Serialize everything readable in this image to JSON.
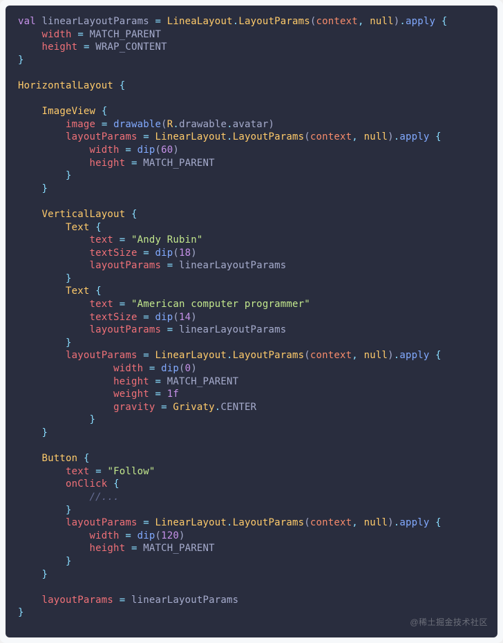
{
  "watermark": "@稀土掘金技术社区",
  "code": {
    "tokens": [
      [
        [
          "kw-val",
          "val"
        ],
        [
          "plain",
          " "
        ],
        [
          "name",
          "linearLayoutParams"
        ],
        [
          "plain",
          " "
        ],
        [
          "op",
          "="
        ],
        [
          "plain",
          " "
        ],
        [
          "type",
          "LineaLayout"
        ],
        [
          "punct",
          "."
        ],
        [
          "type",
          "LayoutParams"
        ],
        [
          "paren",
          "("
        ],
        [
          "param",
          "context"
        ],
        [
          "punct",
          ","
        ],
        [
          "plain",
          " "
        ],
        [
          "type",
          "null"
        ],
        [
          "paren",
          ")"
        ],
        [
          "punct",
          "."
        ],
        [
          "func",
          "apply"
        ],
        [
          "plain",
          " "
        ],
        [
          "punct",
          "{"
        ]
      ],
      [
        [
          "plain",
          "    "
        ],
        [
          "prop",
          "width"
        ],
        [
          "plain",
          " "
        ],
        [
          "op",
          "="
        ],
        [
          "plain",
          " "
        ],
        [
          "const",
          "MATCH_PARENT"
        ]
      ],
      [
        [
          "plain",
          "    "
        ],
        [
          "prop",
          "height"
        ],
        [
          "plain",
          " "
        ],
        [
          "op",
          "="
        ],
        [
          "plain",
          " "
        ],
        [
          "const",
          "WRAP_CONTENT"
        ]
      ],
      [
        [
          "punct",
          "}"
        ]
      ],
      [],
      [
        [
          "type",
          "HorizontalLayout"
        ],
        [
          "plain",
          " "
        ],
        [
          "punct",
          "{"
        ]
      ],
      [],
      [
        [
          "plain",
          "    "
        ],
        [
          "type",
          "ImageView"
        ],
        [
          "plain",
          " "
        ],
        [
          "punct",
          "{"
        ]
      ],
      [
        [
          "plain",
          "        "
        ],
        [
          "prop",
          "image"
        ],
        [
          "plain",
          " "
        ],
        [
          "op",
          "="
        ],
        [
          "plain",
          " "
        ],
        [
          "func",
          "drawable"
        ],
        [
          "paren",
          "("
        ],
        [
          "type",
          "R"
        ],
        [
          "punct",
          "."
        ],
        [
          "name",
          "drawable"
        ],
        [
          "punct",
          "."
        ],
        [
          "name",
          "avatar"
        ],
        [
          "paren",
          ")"
        ]
      ],
      [
        [
          "plain",
          "        "
        ],
        [
          "prop",
          "layoutParams"
        ],
        [
          "plain",
          " "
        ],
        [
          "op",
          "="
        ],
        [
          "plain",
          " "
        ],
        [
          "type",
          "LinearLayout"
        ],
        [
          "punct",
          "."
        ],
        [
          "type",
          "LayoutParams"
        ],
        [
          "paren",
          "("
        ],
        [
          "param",
          "context"
        ],
        [
          "punct",
          ","
        ],
        [
          "plain",
          " "
        ],
        [
          "type",
          "null"
        ],
        [
          "paren",
          ")"
        ],
        [
          "punct",
          "."
        ],
        [
          "func",
          "apply"
        ],
        [
          "plain",
          " "
        ],
        [
          "punct",
          "{"
        ]
      ],
      [
        [
          "plain",
          "            "
        ],
        [
          "prop",
          "width"
        ],
        [
          "plain",
          " "
        ],
        [
          "op",
          "="
        ],
        [
          "plain",
          " "
        ],
        [
          "func",
          "dip"
        ],
        [
          "paren",
          "("
        ],
        [
          "num",
          "60"
        ],
        [
          "paren",
          ")"
        ]
      ],
      [
        [
          "plain",
          "            "
        ],
        [
          "prop",
          "height"
        ],
        [
          "plain",
          " "
        ],
        [
          "op",
          "="
        ],
        [
          "plain",
          " "
        ],
        [
          "const",
          "MATCH_PARENT"
        ]
      ],
      [
        [
          "plain",
          "        "
        ],
        [
          "punct",
          "}"
        ]
      ],
      [
        [
          "plain",
          "    "
        ],
        [
          "punct",
          "}"
        ]
      ],
      [],
      [
        [
          "plain",
          "    "
        ],
        [
          "type",
          "VerticalLayout"
        ],
        [
          "plain",
          " "
        ],
        [
          "punct",
          "{"
        ]
      ],
      [
        [
          "plain",
          "        "
        ],
        [
          "type",
          "Text"
        ],
        [
          "plain",
          " "
        ],
        [
          "punct",
          "{"
        ]
      ],
      [
        [
          "plain",
          "            "
        ],
        [
          "prop",
          "text"
        ],
        [
          "plain",
          " "
        ],
        [
          "op",
          "="
        ],
        [
          "plain",
          " "
        ],
        [
          "str",
          "\"Andy Rubin\""
        ]
      ],
      [
        [
          "plain",
          "            "
        ],
        [
          "prop",
          "textSize"
        ],
        [
          "plain",
          " "
        ],
        [
          "op",
          "="
        ],
        [
          "plain",
          " "
        ],
        [
          "func",
          "dip"
        ],
        [
          "paren",
          "("
        ],
        [
          "num",
          "18"
        ],
        [
          "paren",
          ")"
        ]
      ],
      [
        [
          "plain",
          "            "
        ],
        [
          "prop",
          "layoutParams"
        ],
        [
          "plain",
          " "
        ],
        [
          "op",
          "="
        ],
        [
          "plain",
          " "
        ],
        [
          "name",
          "linearLayoutParams"
        ]
      ],
      [
        [
          "plain",
          "        "
        ],
        [
          "punct",
          "}"
        ]
      ],
      [
        [
          "plain",
          "        "
        ],
        [
          "type",
          "Text"
        ],
        [
          "plain",
          " "
        ],
        [
          "punct",
          "{"
        ]
      ],
      [
        [
          "plain",
          "            "
        ],
        [
          "prop",
          "text"
        ],
        [
          "plain",
          " "
        ],
        [
          "op",
          "="
        ],
        [
          "plain",
          " "
        ],
        [
          "str",
          "\"American computer programmer\""
        ]
      ],
      [
        [
          "plain",
          "            "
        ],
        [
          "prop",
          "textSize"
        ],
        [
          "plain",
          " "
        ],
        [
          "op",
          "="
        ],
        [
          "plain",
          " "
        ],
        [
          "func",
          "dip"
        ],
        [
          "paren",
          "("
        ],
        [
          "num",
          "14"
        ],
        [
          "paren",
          ")"
        ]
      ],
      [
        [
          "plain",
          "            "
        ],
        [
          "prop",
          "layoutParams"
        ],
        [
          "plain",
          " "
        ],
        [
          "op",
          "="
        ],
        [
          "plain",
          " "
        ],
        [
          "name",
          "linearLayoutParams"
        ]
      ],
      [
        [
          "plain",
          "        "
        ],
        [
          "punct",
          "}"
        ]
      ],
      [
        [
          "plain",
          "        "
        ],
        [
          "prop",
          "layoutParams"
        ],
        [
          "plain",
          " "
        ],
        [
          "op",
          "="
        ],
        [
          "plain",
          " "
        ],
        [
          "type",
          "LinearLayout"
        ],
        [
          "punct",
          "."
        ],
        [
          "type",
          "LayoutParams"
        ],
        [
          "paren",
          "("
        ],
        [
          "param",
          "context"
        ],
        [
          "punct",
          ","
        ],
        [
          "plain",
          " "
        ],
        [
          "type",
          "null"
        ],
        [
          "paren",
          ")"
        ],
        [
          "punct",
          "."
        ],
        [
          "func",
          "apply"
        ],
        [
          "plain",
          " "
        ],
        [
          "punct",
          "{"
        ]
      ],
      [
        [
          "plain",
          "                "
        ],
        [
          "prop",
          "width"
        ],
        [
          "plain",
          " "
        ],
        [
          "op",
          "="
        ],
        [
          "plain",
          " "
        ],
        [
          "func",
          "dip"
        ],
        [
          "paren",
          "("
        ],
        [
          "num",
          "0"
        ],
        [
          "paren",
          ")"
        ]
      ],
      [
        [
          "plain",
          "                "
        ],
        [
          "prop",
          "height"
        ],
        [
          "plain",
          " "
        ],
        [
          "op",
          "="
        ],
        [
          "plain",
          " "
        ],
        [
          "const",
          "MATCH_PARENT"
        ]
      ],
      [
        [
          "plain",
          "                "
        ],
        [
          "prop",
          "weight"
        ],
        [
          "plain",
          " "
        ],
        [
          "op",
          "="
        ],
        [
          "plain",
          " "
        ],
        [
          "num",
          "1f"
        ]
      ],
      [
        [
          "plain",
          "                "
        ],
        [
          "prop",
          "gravity"
        ],
        [
          "plain",
          " "
        ],
        [
          "op",
          "="
        ],
        [
          "plain",
          " "
        ],
        [
          "type",
          "Grivaty"
        ],
        [
          "punct",
          "."
        ],
        [
          "const",
          "CENTER"
        ]
      ],
      [
        [
          "plain",
          "            "
        ],
        [
          "punct",
          "}"
        ]
      ],
      [
        [
          "plain",
          "    "
        ],
        [
          "punct",
          "}"
        ]
      ],
      [],
      [
        [
          "plain",
          "    "
        ],
        [
          "type",
          "Button"
        ],
        [
          "plain",
          " "
        ],
        [
          "punct",
          "{"
        ]
      ],
      [
        [
          "plain",
          "        "
        ],
        [
          "prop",
          "text"
        ],
        [
          "plain",
          " "
        ],
        [
          "op",
          "="
        ],
        [
          "plain",
          " "
        ],
        [
          "str",
          "\"Follow\""
        ]
      ],
      [
        [
          "plain",
          "        "
        ],
        [
          "prop",
          "onClick"
        ],
        [
          "plain",
          " "
        ],
        [
          "punct",
          "{"
        ]
      ],
      [
        [
          "plain",
          "            "
        ],
        [
          "comment",
          "//..."
        ]
      ],
      [
        [
          "plain",
          "        "
        ],
        [
          "punct",
          "}"
        ]
      ],
      [
        [
          "plain",
          "        "
        ],
        [
          "prop",
          "layoutParams"
        ],
        [
          "plain",
          " "
        ],
        [
          "op",
          "="
        ],
        [
          "plain",
          " "
        ],
        [
          "type",
          "LinearLayout"
        ],
        [
          "punct",
          "."
        ],
        [
          "type",
          "LayoutParams"
        ],
        [
          "paren",
          "("
        ],
        [
          "param",
          "context"
        ],
        [
          "punct",
          ","
        ],
        [
          "plain",
          " "
        ],
        [
          "type",
          "null"
        ],
        [
          "paren",
          ")"
        ],
        [
          "punct",
          "."
        ],
        [
          "func",
          "apply"
        ],
        [
          "plain",
          " "
        ],
        [
          "punct",
          "{"
        ]
      ],
      [
        [
          "plain",
          "            "
        ],
        [
          "prop",
          "width"
        ],
        [
          "plain",
          " "
        ],
        [
          "op",
          "="
        ],
        [
          "plain",
          " "
        ],
        [
          "func",
          "dip"
        ],
        [
          "paren",
          "("
        ],
        [
          "num",
          "120"
        ],
        [
          "paren",
          ")"
        ]
      ],
      [
        [
          "plain",
          "            "
        ],
        [
          "prop",
          "height"
        ],
        [
          "plain",
          " "
        ],
        [
          "op",
          "="
        ],
        [
          "plain",
          " "
        ],
        [
          "const",
          "MATCH_PARENT"
        ]
      ],
      [
        [
          "plain",
          "        "
        ],
        [
          "punct",
          "}"
        ]
      ],
      [
        [
          "plain",
          "    "
        ],
        [
          "punct",
          "}"
        ]
      ],
      [],
      [
        [
          "plain",
          "    "
        ],
        [
          "prop",
          "layoutParams"
        ],
        [
          "plain",
          " "
        ],
        [
          "op",
          "="
        ],
        [
          "plain",
          " "
        ],
        [
          "name",
          "linearLayoutParams"
        ]
      ],
      [
        [
          "punct",
          "}"
        ]
      ]
    ]
  }
}
